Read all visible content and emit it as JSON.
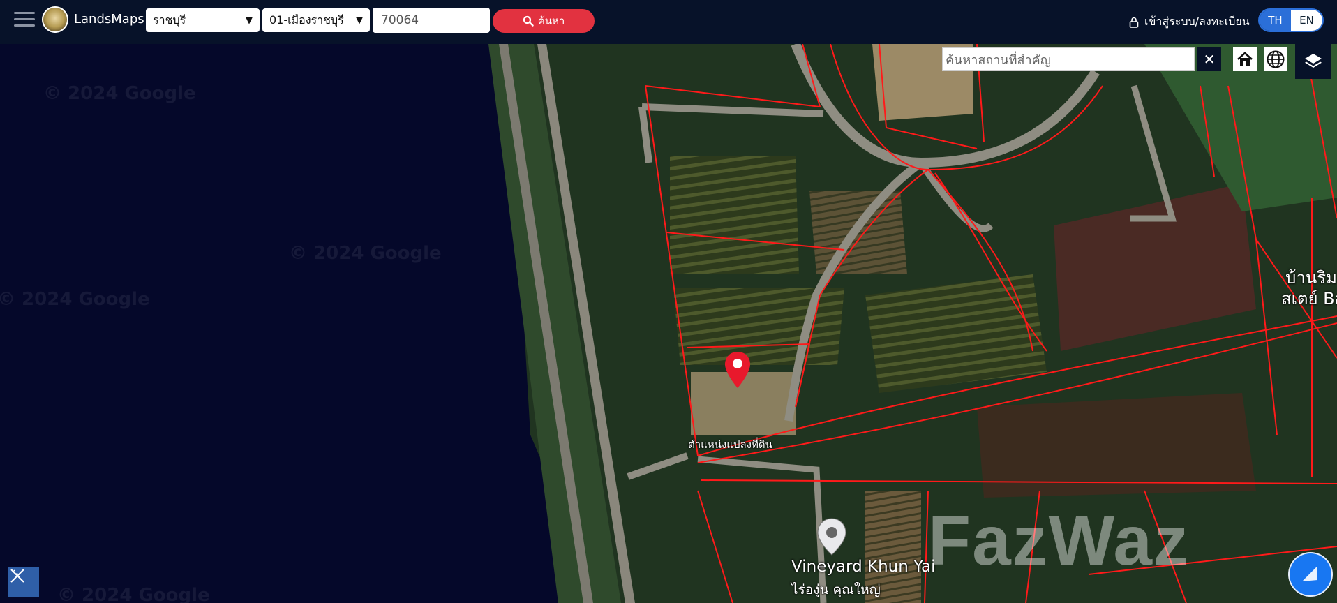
{
  "header": {
    "brand": "LandsMaps",
    "province": "ราชบุรี",
    "district": "01-เมืองราชบุรี",
    "postcode": "70064",
    "search_label": "ค้นหา",
    "login_label": "เข้าสู่ระบบ/ลงทะเบียน",
    "lang_th": "TH",
    "lang_en": "EN"
  },
  "map": {
    "place_search_placeholder": "ค้นหาสถานที่สำคัญ",
    "clear_label": "✕",
    "pin_label": "ตำแหน่งแปลงที่ดิน",
    "poi_name_en": "Vineyard Khun Yai",
    "poi_name_th": "ไร่องุ่น คุณใหญ่",
    "village_line1": "บ้านริม",
    "village_line2": "สเตย์ Ba",
    "watermark": "© 2024 Google",
    "brand_watermark": "FazWaz"
  },
  "colors": {
    "topbar": "#071229",
    "search_button": "#e23240",
    "lang_active": "#2b6fd8",
    "parcel_line": "#ff1a1a",
    "pin": "#e8192c"
  }
}
